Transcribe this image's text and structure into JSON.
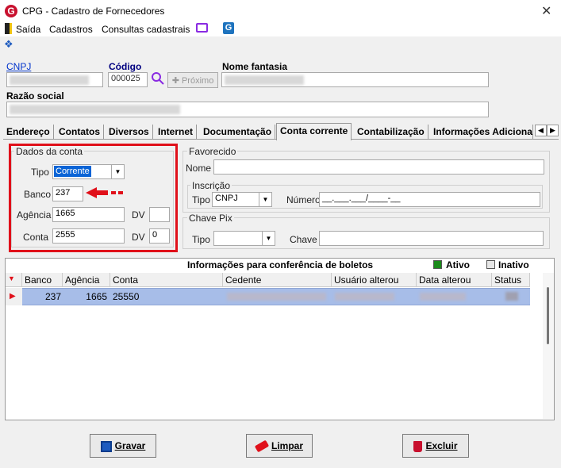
{
  "window": {
    "title": "CPG - Cadastro de Fornecedores"
  },
  "menu": {
    "items": [
      "Saída",
      "Cadastros",
      "Consultas cadastrais"
    ]
  },
  "header": {
    "cnpj_label": "CNPJ",
    "codigo_label": "Código",
    "codigo_value": "000025",
    "proximo_label": "Próximo",
    "nome_fantasia_label": "Nome fantasia",
    "razao_social_label": "Razão social"
  },
  "tabs": [
    "Endereço",
    "Contatos",
    "Diversos",
    "Internet",
    "Documentação",
    "Conta corrente",
    "Contabilização",
    "Informações Adicionai"
  ],
  "dados_conta": {
    "title": "Dados da conta",
    "tipo_label": "Tipo",
    "tipo_value": "Corrente",
    "banco_label": "Banco",
    "banco_value": "237",
    "agencia_label": "Agência",
    "agencia_value": "1665",
    "dv_label": "DV",
    "agencia_dv": "",
    "conta_label": "Conta",
    "conta_value": "2555",
    "conta_dv": "0"
  },
  "favorecido": {
    "title": "Favorecido",
    "nome_label": "Nome",
    "inscricao_title": "Inscrição",
    "tipo_label": "Tipo",
    "tipo_value": "CNPJ",
    "numero_label": "Número",
    "numero_value": "__.___.___/____-__"
  },
  "chave_pix": {
    "title": "Chave Pix",
    "tipo_label": "Tipo",
    "chave_label": "Chave"
  },
  "boletos": {
    "title": "Informações para conferência de boletos",
    "ativo_label": "Ativo",
    "inativo_label": "Inativo",
    "columns": [
      "Banco",
      "Agência",
      "Conta",
      "Cedente",
      "Usuário alterou",
      "Data alterou",
      "Status"
    ],
    "rows": [
      {
        "banco": "237",
        "agencia": "1665",
        "conta": "25550"
      }
    ]
  },
  "buttons": {
    "gravar": "Gravar",
    "limpar": "Limpar",
    "excluir": "Excluir"
  },
  "colors": {
    "accent_red": "#e0101a",
    "selection": "#a7bde8",
    "ativo_green": "#1a8a1a"
  }
}
